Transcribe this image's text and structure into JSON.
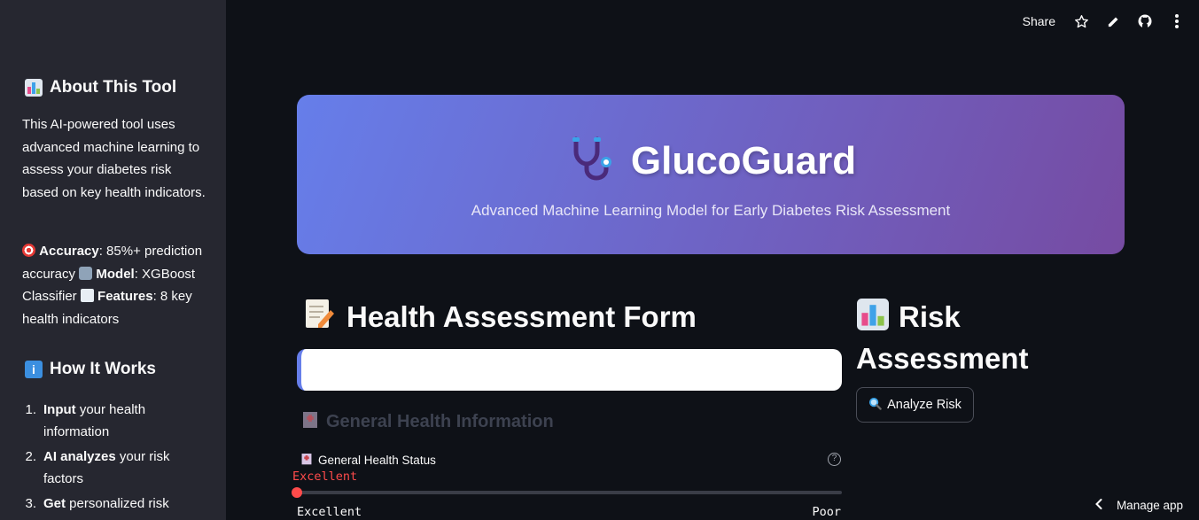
{
  "sidebar": {
    "about_title": "About This Tool",
    "about_text": "This AI-powered tool uses advanced machine learning to assess your diabetes risk based on key health indicators.",
    "stats": {
      "accuracy_label": "Accuracy",
      "accuracy_value": ": 85%+ prediction accuracy",
      "model_label": "Model",
      "model_value": ": XGBoost Classifier",
      "features_label": "Features",
      "features_value": ": 8 key health indicators"
    },
    "how_title": "How It Works",
    "steps": [
      {
        "n": "1.",
        "bold": "Input",
        "rest": " your health information"
      },
      {
        "n": "2.",
        "bold": "AI analyzes",
        "rest": " your risk factors"
      },
      {
        "n": "3.",
        "bold": "Get",
        "rest": " personalized risk"
      }
    ]
  },
  "topbar": {
    "share": "Share"
  },
  "hero": {
    "title": "GlucoGuard",
    "subtitle": "Advanced Machine Learning Model for Early Diabetes Risk Assessment"
  },
  "form": {
    "title": "Health Assessment Form",
    "section": "General Health Information",
    "field_label": "General Health Status",
    "help": "?",
    "slider_value": "Excellent",
    "slider_level": 0,
    "min_label": "Excellent",
    "max_label": "Poor"
  },
  "risk": {
    "title": "Risk Assessment",
    "button": "Analyze Risk"
  },
  "footer": {
    "manage": "Manage app"
  },
  "colors": {
    "accent": "#ff4b4b",
    "hero_start": "#667eea",
    "hero_end": "#764ba2"
  }
}
